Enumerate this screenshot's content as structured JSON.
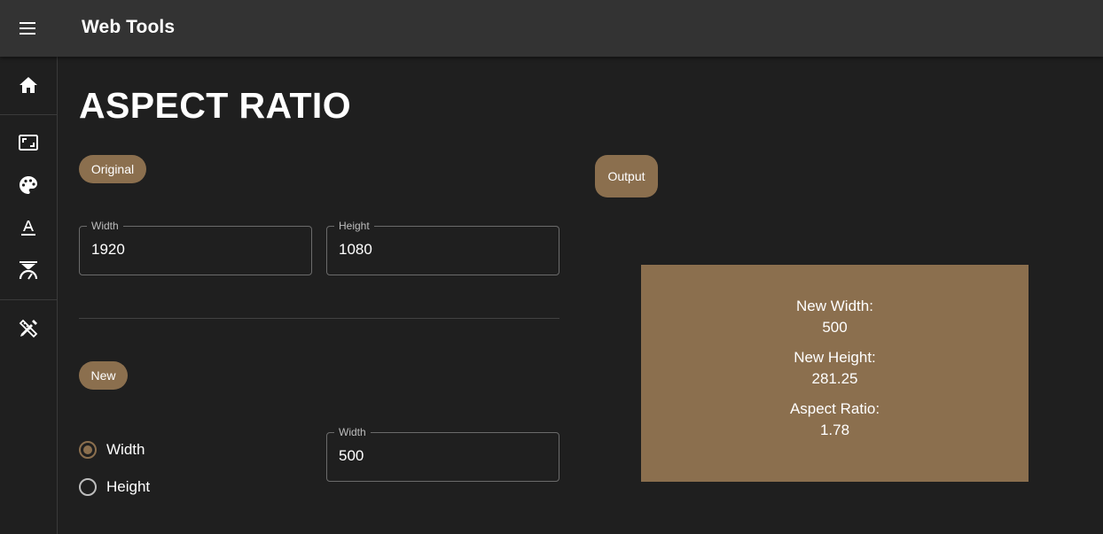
{
  "app": {
    "title": "Web Tools"
  },
  "sidebar": {
    "items": [
      {
        "icon": "home-icon",
        "label": "Home"
      },
      {
        "icon": "aspect-ratio-icon",
        "label": "Aspect Ratio"
      },
      {
        "icon": "palette-icon",
        "label": "Colors"
      },
      {
        "icon": "text-format-icon",
        "label": "Fonts"
      },
      {
        "icon": "speed-gauge-icon",
        "label": "Speed"
      },
      {
        "icon": "design-tools-icon",
        "label": "Tools"
      }
    ]
  },
  "page": {
    "title": "ASPECT RATIO"
  },
  "original": {
    "chip_label": "Original",
    "width": {
      "label": "Width",
      "value": "1920"
    },
    "height": {
      "label": "Height",
      "value": "1080"
    }
  },
  "new_section": {
    "chip_label": "New",
    "options": [
      {
        "label": "Width",
        "checked": true
      },
      {
        "label": "Height",
        "checked": false
      }
    ],
    "input": {
      "label": "Width",
      "value": "500"
    }
  },
  "output": {
    "chip_label": "Output",
    "new_width_label": "New Width:",
    "new_width_value": "500",
    "new_height_label": "New Height:",
    "new_height_value": "281.25",
    "aspect_ratio_label": "Aspect Ratio:",
    "aspect_ratio_value": "1.78"
  },
  "colors": {
    "accent": "#8b6f4e",
    "background": "#1f1f1f",
    "appbar": "#333333"
  }
}
